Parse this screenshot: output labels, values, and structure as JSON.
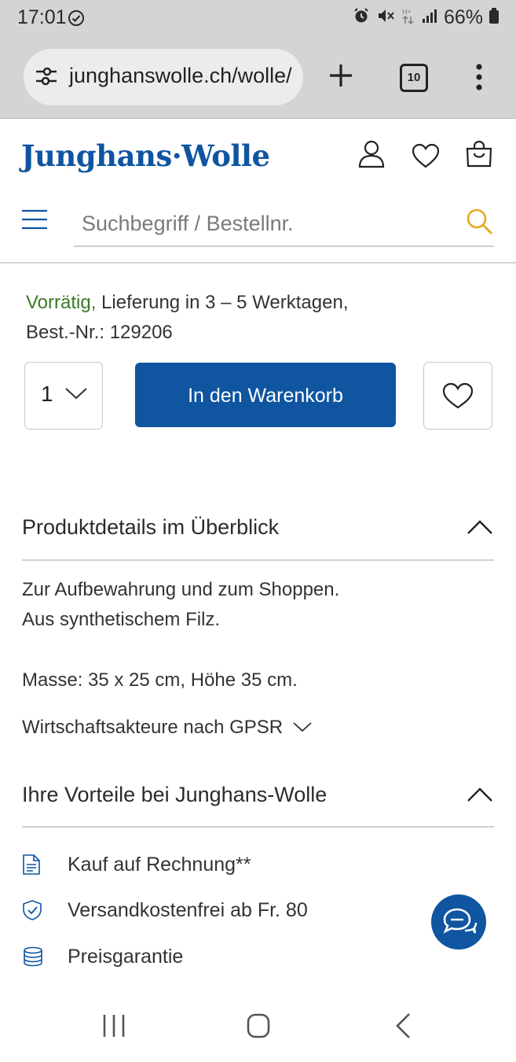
{
  "status_bar": {
    "time": "17:01",
    "battery": "66%",
    "icons": [
      "check-circle-icon",
      "alarm-icon",
      "mute-icon",
      "data-icon",
      "signal-icon",
      "battery-icon"
    ]
  },
  "browser": {
    "url": "junghanswolle.ch/wolle/",
    "tab_count": "10",
    "icons": [
      "tune-icon",
      "plus-icon",
      "tabs-icon",
      "more-vert-icon"
    ]
  },
  "header": {
    "logo": "Junghans·Wolle",
    "search_placeholder": "Suchbegriff / Bestellnr.",
    "icons": [
      "hamburger-icon",
      "user-icon",
      "heart-icon",
      "bag-icon",
      "search-icon"
    ]
  },
  "product": {
    "availability": "Vorrätig,",
    "delivery": " Lieferung in 3 – 5 Werktagen,",
    "order_number": "Best.-Nr.: 129206",
    "quantity": "1",
    "add_to_cart": "In den Warenkorb"
  },
  "details": {
    "title": "Produktdetails im Überblick",
    "line1": "Zur Aufbewahrung und zum Shoppen.",
    "line2": "Aus synthetischem Filz.",
    "dimensions": "Masse: 35 x 25 cm, Höhe 35 cm.",
    "gpsr": "Wirtschaftsakteure nach GPSR"
  },
  "benefits": {
    "title": "Ihre Vorteile bei Junghans-Wolle",
    "items": [
      {
        "label": "Kauf auf Rechnung**",
        "icon": "invoice-icon"
      },
      {
        "label": "Versandkostenfrei ab Fr. 80",
        "icon": "shield-check-icon"
      },
      {
        "label": "Preisgarantie",
        "icon": "coins-icon"
      }
    ]
  },
  "colors": {
    "brand_blue": "#0f55a0",
    "in_stock_green": "#3a7a26",
    "search_accent": "#e8a820"
  }
}
